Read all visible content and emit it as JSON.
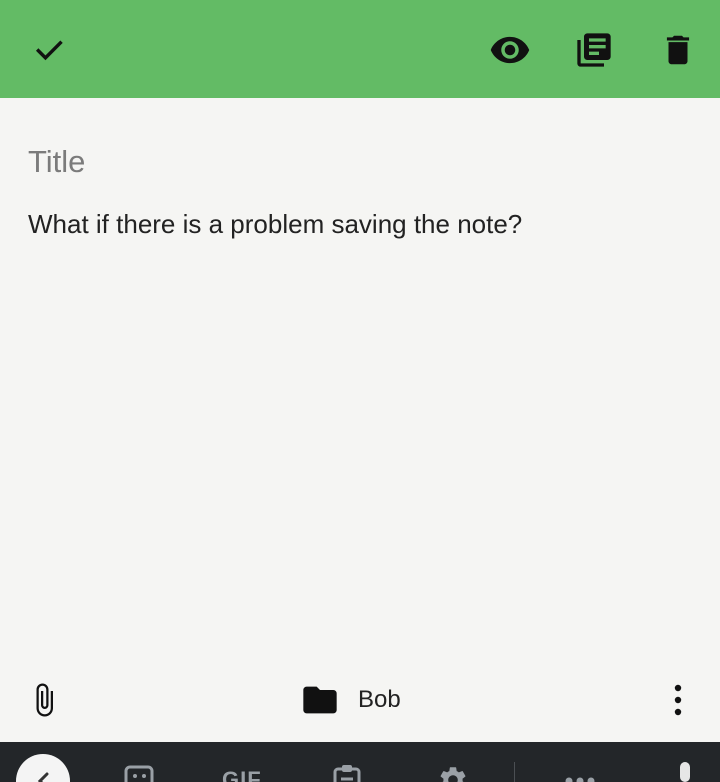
{
  "toolbar": {
    "background_color": "#63bb65",
    "icons": [
      "check-icon",
      "eye-icon",
      "notes-stack-icon",
      "trash-icon"
    ]
  },
  "editor": {
    "title_placeholder": "Title",
    "title_value": "",
    "body": "What if there is a problem saving the note?"
  },
  "bottom_bar": {
    "folder_label": "Bob",
    "icons": [
      "paperclip-icon",
      "folder-icon",
      "more-vertical-icon"
    ]
  },
  "keyboard_bar": {
    "gif_label": "GIF",
    "icons": [
      "chevron-left-icon",
      "sticker-icon",
      "gif-icon",
      "clipboard-icon",
      "gear-icon",
      "more-horizontal-icon",
      "mic-icon"
    ]
  }
}
